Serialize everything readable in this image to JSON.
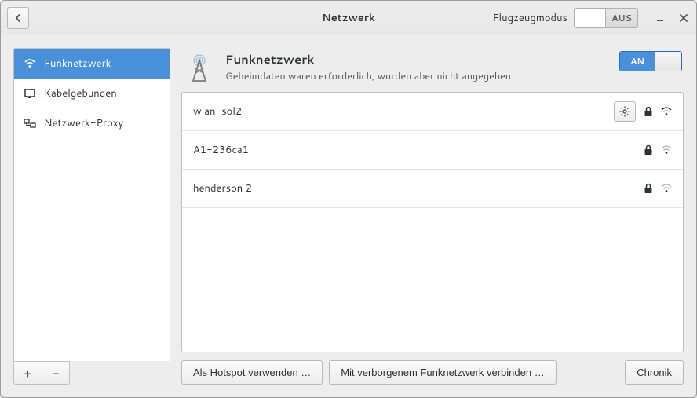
{
  "titlebar": {
    "title": "Netzwerk",
    "airplane_label": "Flugzeugmodus",
    "airplane_state": "AUS"
  },
  "sidebar": {
    "items": [
      {
        "label": "Funknetzwerk",
        "icon": "wifi"
      },
      {
        "label": "Kabelgebunden",
        "icon": "wired"
      },
      {
        "label": "Netzwerk-Proxy",
        "icon": "proxy"
      }
    ]
  },
  "header": {
    "title": "Funknetzwerk",
    "subtitle": "Geheimdaten waren erforderlich, wurden aber nicht angegeben",
    "toggle_on": "AN"
  },
  "networks": [
    {
      "name": "wlan-sol2",
      "has_settings": true,
      "locked": true
    },
    {
      "name": "A1-236ca1",
      "has_settings": false,
      "locked": true
    },
    {
      "name": "henderson 2",
      "has_settings": false,
      "locked": true
    }
  ],
  "footer": {
    "hotspot": "Als Hotspot verwenden …",
    "hidden": "Mit verborgenem Funknetzwerk verbinden …",
    "history": "Chronik"
  }
}
